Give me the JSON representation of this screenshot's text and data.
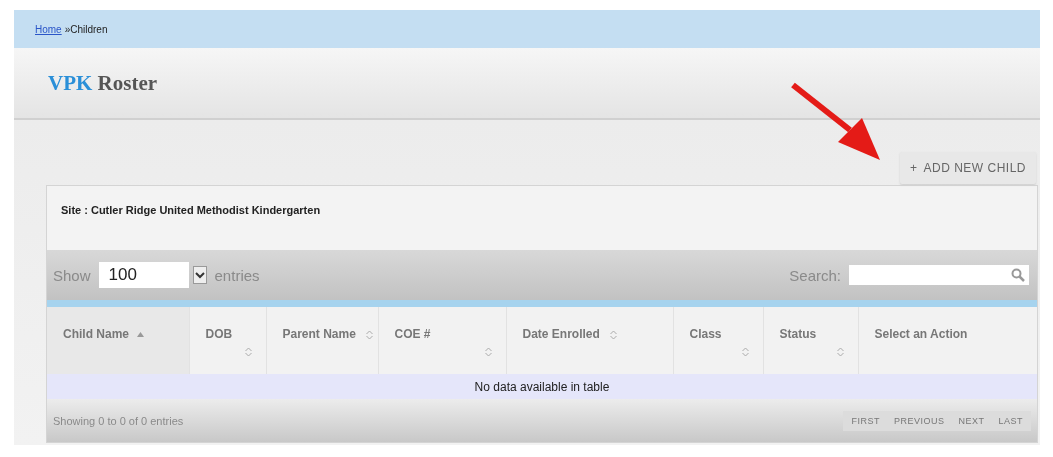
{
  "breadcrumb": {
    "link": "Home",
    "separator": "»",
    "current": "Children"
  },
  "page_title": {
    "accent": "VPK",
    "rest": "Roster"
  },
  "add_button": {
    "icon": "+",
    "label": "ADD NEW CHILD"
  },
  "site": "Site : Cutler Ridge United Methodist Kindergarten",
  "length_menu": {
    "before": "Show",
    "value": "100",
    "after": "entries"
  },
  "search": {
    "label": "Search:"
  },
  "table": {
    "columns": [
      {
        "label": "Child Name",
        "sortable": true,
        "sorted": true
      },
      {
        "label": "DOB",
        "sortable": true,
        "sorted": false
      },
      {
        "label": "Parent Name",
        "sortable": true,
        "sorted": false
      },
      {
        "label": "COE #",
        "sortable": true,
        "sorted": false
      },
      {
        "label": "Date Enrolled",
        "sortable": true,
        "sorted": false
      },
      {
        "label": "Class",
        "sortable": true,
        "sorted": false
      },
      {
        "label": "Status",
        "sortable": true,
        "sorted": false
      },
      {
        "label": "Select an Action",
        "sortable": false
      }
    ],
    "empty_message": "No data available in table"
  },
  "info": "Showing 0 to 0 of 0 entries",
  "pagination": [
    {
      "label": "FIRST",
      "disabled": true
    },
    {
      "label": "PREVIOUS",
      "disabled": true
    },
    {
      "label": "NEXT",
      "disabled": true
    },
    {
      "label": "LAST",
      "disabled": true
    }
  ]
}
